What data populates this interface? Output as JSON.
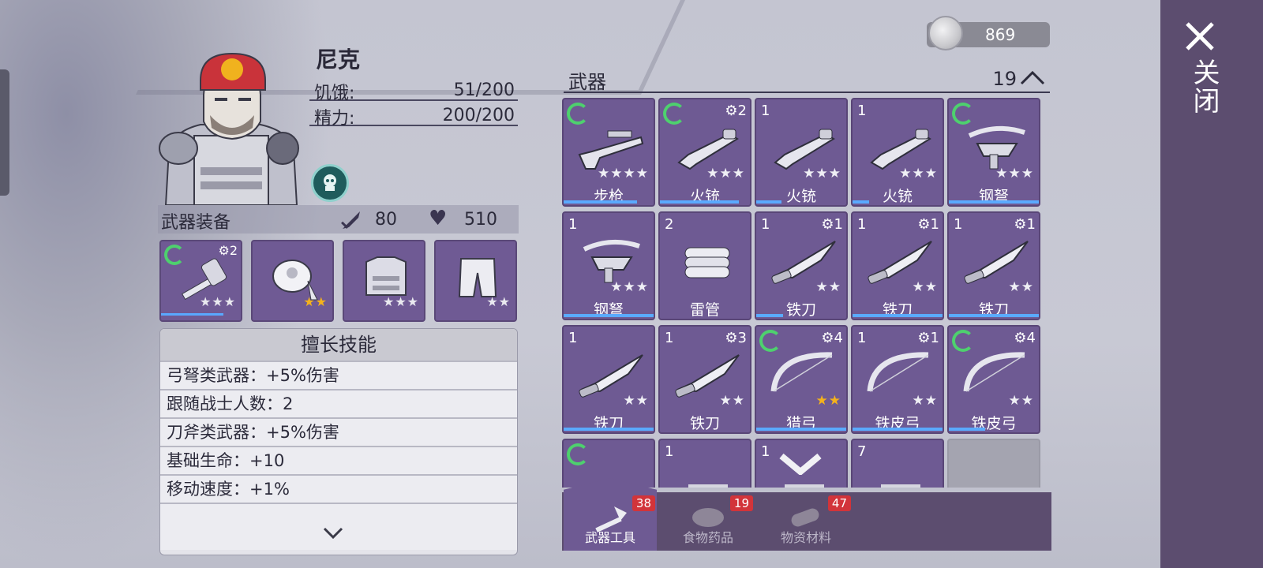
{
  "character": {
    "name": "尼克",
    "hunger_label": "饥饿:",
    "hunger_value": "51/200",
    "energy_label": "精力:",
    "energy_value": "200/200"
  },
  "equipment": {
    "title": "武器装备",
    "attack": "80",
    "health": "510",
    "slots": [
      {
        "icon": "hammer-icon",
        "level": "⚙2",
        "stars": "★★★",
        "gold": false
      },
      {
        "icon": "bandana-icon",
        "level": "",
        "stars": "★★",
        "gold": true
      },
      {
        "icon": "vest-icon",
        "level": "",
        "stars": "★★★",
        "gold": false
      },
      {
        "icon": "pants-icon",
        "level": "",
        "stars": "★★",
        "gold": false
      }
    ]
  },
  "skills": {
    "title": "擅长技能",
    "items": [
      "弓弩类武器：+5%伤害",
      "跟随战士人数：2",
      "刀斧类武器：+5%伤害",
      "基础生命：+10",
      "移动速度：+1%"
    ]
  },
  "currency": {
    "coins": "869"
  },
  "inventory": {
    "section": "武器",
    "count": "19",
    "items": [
      {
        "name": "步枪",
        "qty": "",
        "level": "",
        "stars": "★★★★",
        "gold": false,
        "icon": "rifle-icon"
      },
      {
        "name": "火铳",
        "qty": "",
        "level": "⚙2",
        "stars": "★★★",
        "gold": false,
        "icon": "blunderbuss-icon"
      },
      {
        "name": "火铳",
        "qty": "1",
        "level": "",
        "stars": "★★★",
        "gold": false,
        "icon": "blunderbuss-icon"
      },
      {
        "name": "火铳",
        "qty": "1",
        "level": "",
        "stars": "★★★",
        "gold": false,
        "icon": "blunderbuss-icon"
      },
      {
        "name": "钢弩",
        "qty": "",
        "level": "",
        "stars": "★★★",
        "gold": false,
        "icon": "crossbow-icon"
      },
      {
        "name": "钢弩",
        "qty": "1",
        "level": "",
        "stars": "★★★",
        "gold": false,
        "icon": "crossbow-icon"
      },
      {
        "name": "雷管",
        "qty": "2",
        "level": "",
        "stars": "",
        "gold": false,
        "icon": "dynamite-icon"
      },
      {
        "name": "铁刀",
        "qty": "1",
        "level": "⚙1",
        "stars": "★★",
        "gold": false,
        "icon": "knife-icon"
      },
      {
        "name": "铁刀",
        "qty": "1",
        "level": "⚙1",
        "stars": "★★",
        "gold": false,
        "icon": "knife-icon"
      },
      {
        "name": "铁刀",
        "qty": "1",
        "level": "⚙1",
        "stars": "★★",
        "gold": false,
        "icon": "knife-icon"
      },
      {
        "name": "铁刀",
        "qty": "1",
        "level": "",
        "stars": "★★",
        "gold": false,
        "icon": "knife-icon"
      },
      {
        "name": "铁刀",
        "qty": "1",
        "level": "⚙3",
        "stars": "★★",
        "gold": false,
        "icon": "knife-icon"
      },
      {
        "name": "猎弓",
        "qty": "",
        "level": "⚙4",
        "stars": "★★",
        "gold": true,
        "icon": "bow-icon"
      },
      {
        "name": "铁皮弓",
        "qty": "1",
        "level": "⚙1",
        "stars": "★★",
        "gold": false,
        "icon": "bow-icon"
      },
      {
        "name": "铁皮弓",
        "qty": "",
        "level": "⚙4",
        "stars": "★★",
        "gold": false,
        "icon": "bow-icon"
      },
      {
        "name": "",
        "qty": "",
        "level": "",
        "stars": "",
        "gold": false,
        "icon": "weapon-icon"
      },
      {
        "name": "",
        "qty": "1",
        "level": "",
        "stars": "",
        "gold": false,
        "icon": "weapon-icon"
      },
      {
        "name": "",
        "qty": "1",
        "level": "",
        "stars": "",
        "gold": false,
        "icon": "weapon-icon"
      },
      {
        "name": "",
        "qty": "7",
        "level": "",
        "stars": "",
        "gold": false,
        "icon": "weapon-icon"
      }
    ]
  },
  "tabs": [
    {
      "label": "武器工具",
      "badge": "38"
    },
    {
      "label": "食物药品",
      "badge": "19"
    },
    {
      "label": "物资材料",
      "badge": "47"
    }
  ],
  "close": {
    "label": "关闭"
  }
}
